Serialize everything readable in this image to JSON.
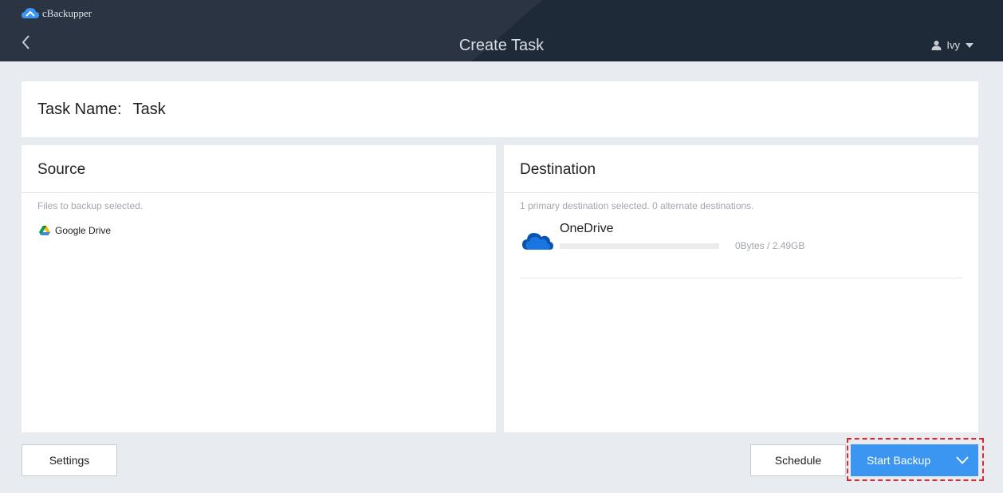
{
  "app": {
    "name": "cBackupper"
  },
  "header": {
    "title": "Create Task",
    "user": "Ivy"
  },
  "task": {
    "label": "Task Name:",
    "value": "Task"
  },
  "source": {
    "title": "Source",
    "note": "Files to backup selected.",
    "items": [
      {
        "label": "Google Drive",
        "icon": "google-drive-icon"
      }
    ]
  },
  "destination": {
    "title": "Destination",
    "note": "1 primary destination selected.  0  alternate destinations.",
    "items": [
      {
        "label": "OneDrive",
        "icon": "onedrive-icon",
        "capacity": "0Bytes / 2.49GB",
        "usage_fraction": 0
      }
    ]
  },
  "footer": {
    "settings": "Settings",
    "schedule": "Schedule",
    "start": "Start Backup"
  },
  "colors": {
    "accent": "#3b96f2",
    "highlight": "#e8262b",
    "header": "#1f2a38"
  }
}
